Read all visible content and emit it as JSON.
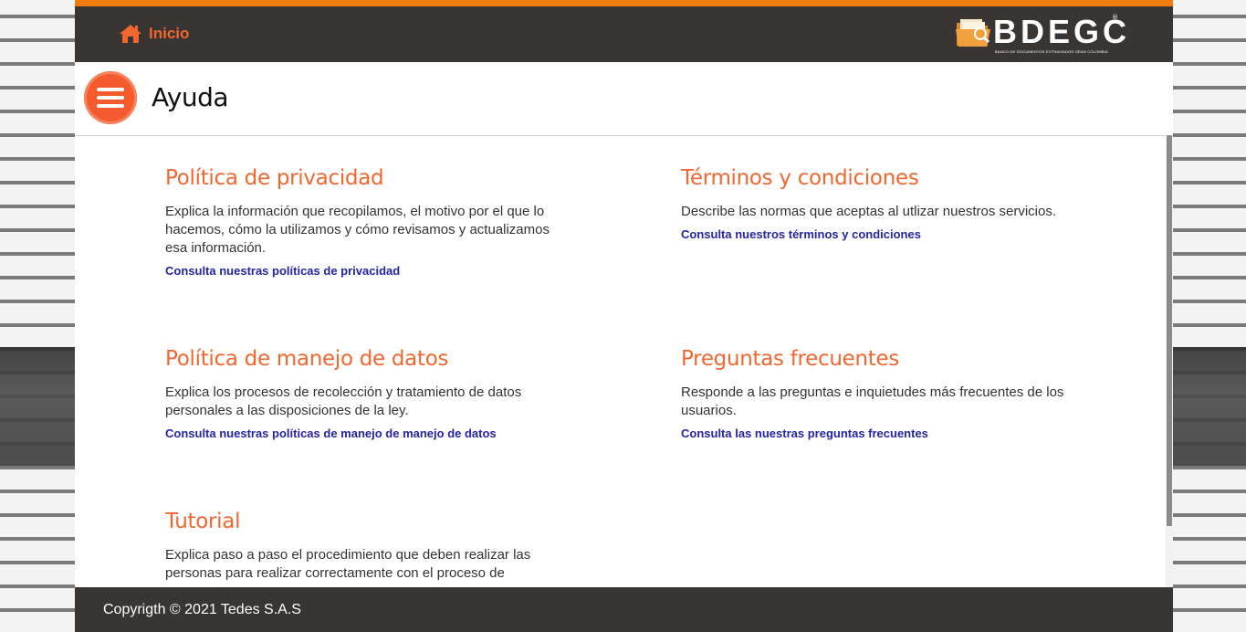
{
  "header": {
    "home_label": "Inicio",
    "logo_text": "BDEGC",
    "logo_tagline": "BANCO DE DOCUMENTOS EXTRAVIADOS GRAN COLOMBIA",
    "logo_registered": "®"
  },
  "page": {
    "title": "Ayuda"
  },
  "sections": [
    {
      "title": "Política de privacidad",
      "description": "Explica la información que recopilamos, el motivo por el que lo hacemos, cómo la utilizamos y cómo revisamos y actualizamos esa información.",
      "link": "Consulta nuestras políticas de privacidad"
    },
    {
      "title": "Términos y condiciones",
      "description": "Describe las normas que aceptas al utlizar nuestros servicios.",
      "link": "Consulta nuestros términos y condiciones"
    },
    {
      "title": "Política de manejo de datos",
      "description": "Explica los procesos de recolección y tratamiento de datos personales a las disposiciones de la ley.",
      "link": "Consulta nuestras políticas de manejo de manejo de datos"
    },
    {
      "title": "Preguntas frecuentes",
      "description": "Responde a las preguntas e inquietudes más frecuentes de los usuarios.",
      "link": "Consulta las nuestras preguntas frecuentes"
    },
    {
      "title": "Tutorial",
      "description": "Explica paso a paso el procedimiento que deben realizar las personas para realizar correctamente con el proceso de"
    }
  ],
  "footer": {
    "copyright": "Copyrigth © 2021 Tedes S.A.S"
  },
  "colors": {
    "accent": "#f2672f",
    "topbar": "#393532",
    "top_border": "#f27c0e",
    "link": "#2424a8"
  },
  "icons": {
    "home": "home-icon",
    "menu": "hamburger-menu-icon",
    "logo": "folder-logo-icon"
  }
}
